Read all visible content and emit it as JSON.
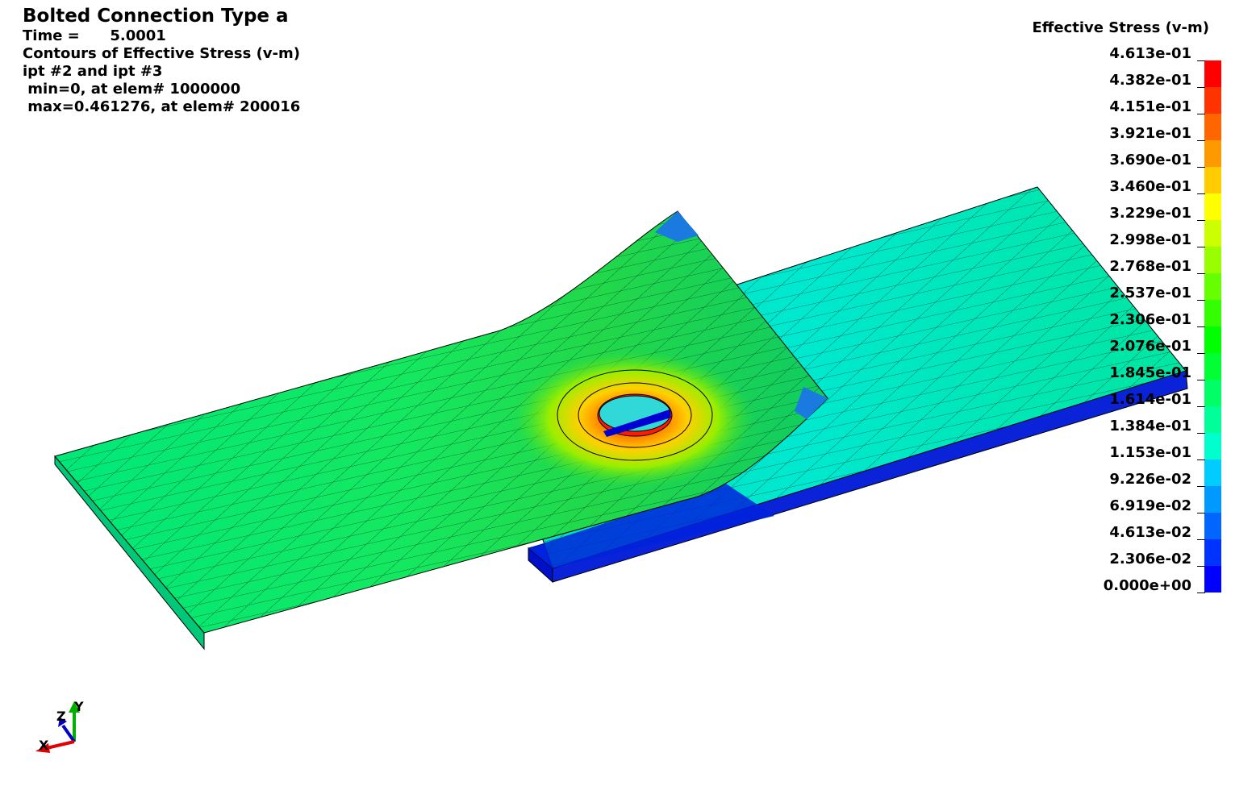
{
  "header": {
    "title": "Bolted Connection Type a",
    "lines": [
      "Time =      5.0001",
      "Contours of Effective Stress (v-m)",
      "ipt #2 and ipt #3",
      " min=0, at elem# 1000000",
      " max=0.461276, at elem# 200016"
    ]
  },
  "legend": {
    "title": "Effective Stress (v-m)",
    "labels": [
      "4.613e-01",
      "4.382e-01",
      "4.151e-01",
      "3.921e-01",
      "3.690e-01",
      "3.460e-01",
      "3.229e-01",
      "2.998e-01",
      "2.768e-01",
      "2.537e-01",
      "2.306e-01",
      "2.076e-01",
      "1.845e-01",
      "1.614e-01",
      "1.384e-01",
      "1.153e-01",
      "9.226e-02",
      "6.919e-02",
      "4.613e-02",
      "2.306e-02",
      "0.000e+00"
    ],
    "colors": [
      "#ff0000",
      "#ff3300",
      "#ff6600",
      "#ff9900",
      "#ffcc00",
      "#ffff00",
      "#ccff00",
      "#99ff00",
      "#66ff00",
      "#33ff00",
      "#00ff00",
      "#00ff33",
      "#00ff66",
      "#00ff99",
      "#00ffcc",
      "#00ccff",
      "#0099ff",
      "#0066ff",
      "#0033ff",
      "#0000ff"
    ]
  },
  "axes": {
    "x": "X",
    "y": "Y",
    "z": "Z"
  }
}
